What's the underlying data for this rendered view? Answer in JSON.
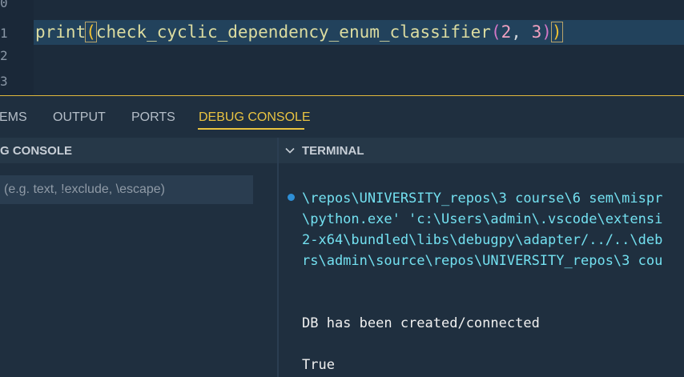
{
  "editor": {
    "line_numbers": [
      "0",
      "1",
      "2",
      "3"
    ],
    "code": {
      "func": "print",
      "open1": "(",
      "call": "check_cyclic_dependency_enum_classifier",
      "open2": "(",
      "arg1": "2",
      "comma": ", ",
      "arg2": "3",
      "close2": ")",
      "close1": ")"
    }
  },
  "panel": {
    "tabs": [
      "EMS",
      "OUTPUT",
      "PORTS",
      "DEBUG CONSOLE"
    ],
    "active_tab": "DEBUG CONSOLE"
  },
  "debug_console": {
    "title": "G CONSOLE",
    "filter_placeholder": "(e.g. text, !exclude, \\escape)"
  },
  "terminal": {
    "title": "TERMINAL",
    "chevron_icon": "chevron-down-icon",
    "lines": [
      "\\repos\\UNIVERSITY_repos\\3 course\\6 sem\\mispr",
      "\\python.exe' 'c:\\Users\\admin\\.vscode\\extensi",
      "2-x64\\bundled\\libs\\debugpy\\adapter/../..\\deb",
      "rs\\admin\\source\\repos\\UNIVERSITY_repos\\3 cou"
    ],
    "output": [
      "DB has been created/connected",
      "True"
    ]
  },
  "colors": {
    "accent": "#e9c341",
    "terminal_text": "#73e0f0",
    "status_dot": "#2e8fd6"
  }
}
